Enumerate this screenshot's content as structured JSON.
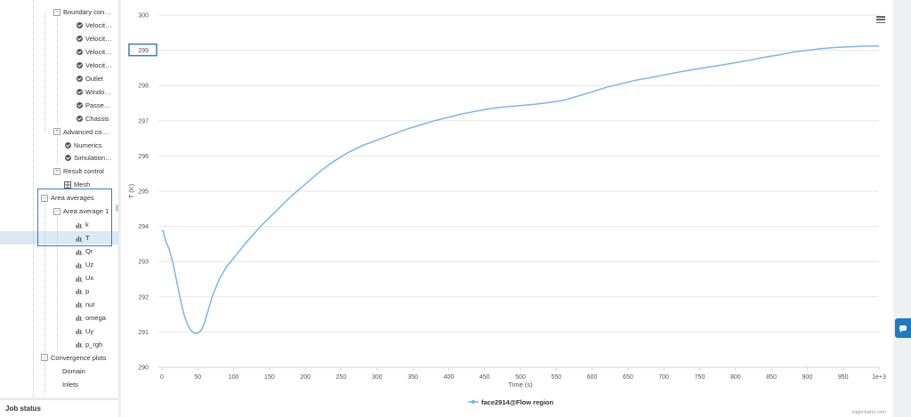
{
  "sidebar": {
    "tree": [
      {
        "label": "Boundary condit...",
        "icon": "expander",
        "expand": "−"
      },
      {
        "label": "Velocity...",
        "icon": "check"
      },
      {
        "label": "Velocity...",
        "icon": "check"
      },
      {
        "label": "Velocity...",
        "icon": "check"
      },
      {
        "label": "Velocity...",
        "icon": "check"
      },
      {
        "label": "Outlet",
        "icon": "check"
      },
      {
        "label": "Windows",
        "icon": "check"
      },
      {
        "label": "Passeng...",
        "icon": "check"
      },
      {
        "label": "Chassis",
        "icon": "check"
      },
      {
        "label": "Advanced conce...",
        "icon": "expander",
        "expand": "+"
      },
      {
        "label": "Numerics",
        "icon": "check"
      },
      {
        "label": "Simulation c...",
        "icon": "check"
      },
      {
        "label": "Result control",
        "icon": "expander",
        "expand": "+"
      },
      {
        "label": "Mesh",
        "icon": "mesh"
      },
      {
        "label": "Area averages",
        "icon": "expander",
        "expand": "−"
      },
      {
        "label": "Area average 1",
        "icon": "expander",
        "expand": "−"
      },
      {
        "label": "k",
        "icon": "chart"
      },
      {
        "label": "T",
        "icon": "chart"
      },
      {
        "label": "Qr",
        "icon": "chart"
      },
      {
        "label": "Uz",
        "icon": "chart"
      },
      {
        "label": "Ux",
        "icon": "chart"
      },
      {
        "label": "p",
        "icon": "chart"
      },
      {
        "label": "nut",
        "icon": "chart"
      },
      {
        "label": "omega",
        "icon": "chart"
      },
      {
        "label": "Uy",
        "icon": "chart"
      },
      {
        "label": "p_rgh",
        "icon": "chart"
      },
      {
        "label": "Convergence plots",
        "icon": "expander",
        "expand": "−"
      },
      {
        "label": "Domain",
        "icon": "none"
      },
      {
        "label": "Inlets",
        "icon": "none"
      }
    ],
    "selected_item": "T",
    "job_status_label": "Job status"
  },
  "chart_data": {
    "type": "line",
    "xlabel": "Time (s)",
    "ylabel": "T (K)",
    "xlim": [
      0,
      1000
    ],
    "ylim": [
      290,
      300
    ],
    "x_ticks": [
      "0",
      "50",
      "100",
      "150",
      "200",
      "250",
      "300",
      "350",
      "400",
      "450",
      "500",
      "550",
      "600",
      "650",
      "700",
      "750",
      "800",
      "850",
      "900",
      "950",
      "1e+3"
    ],
    "y_ticks": [
      "290",
      "291",
      "292",
      "293",
      "294",
      "295",
      "296",
      "297",
      "298",
      "299",
      "300"
    ],
    "highlighted_y_tick": "299",
    "grid": true,
    "legend_position": "bottom-center",
    "series": [
      {
        "name": "face2914@Flow region",
        "color": "#7cb5ec",
        "x": [
          0,
          2,
          5,
          10,
          15,
          20,
          25,
          30,
          35,
          40,
          45,
          50,
          55,
          60,
          65,
          70,
          80,
          90,
          100,
          120,
          140,
          160,
          180,
          200,
          220,
          240,
          260,
          280,
          300,
          320,
          340,
          360,
          380,
          400,
          420,
          440,
          460,
          480,
          500,
          520,
          540,
          560,
          580,
          600,
          620,
          640,
          660,
          680,
          700,
          720,
          740,
          760,
          780,
          800,
          820,
          840,
          860,
          880,
          900,
          920,
          940,
          960,
          980,
          1000
        ],
        "y": [
          293.9,
          293.85,
          293.6,
          293.35,
          293.0,
          292.5,
          292.0,
          291.55,
          291.25,
          291.05,
          290.97,
          290.97,
          291.05,
          291.3,
          291.65,
          292.0,
          292.5,
          292.85,
          293.1,
          293.6,
          294.05,
          294.45,
          294.85,
          295.2,
          295.55,
          295.85,
          296.1,
          296.3,
          296.45,
          296.6,
          296.75,
          296.88,
          297.0,
          297.1,
          297.2,
          297.28,
          297.35,
          297.4,
          297.43,
          297.47,
          297.52,
          297.58,
          297.7,
          297.82,
          297.95,
          298.05,
          298.15,
          298.22,
          298.3,
          298.38,
          298.45,
          298.52,
          298.58,
          298.65,
          298.72,
          298.8,
          298.87,
          298.95,
          299.0,
          299.05,
          299.08,
          299.1,
          299.12,
          299.12
        ]
      }
    ],
    "credit": "Highcharts.com"
  },
  "colors": {
    "accent": "#3a78d0",
    "series": "#7cb5ec",
    "selected_row": "#dbe9f6"
  }
}
